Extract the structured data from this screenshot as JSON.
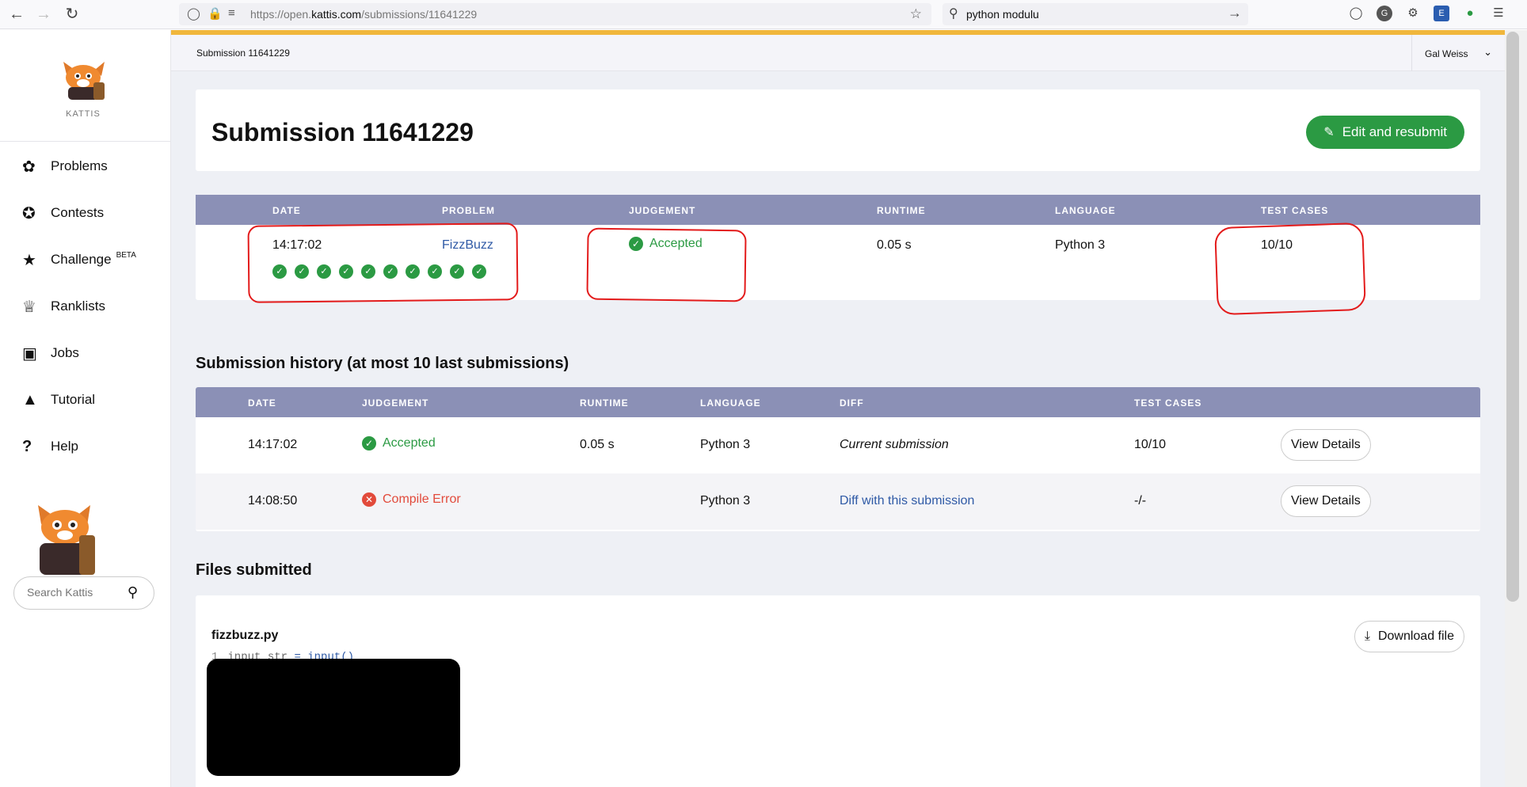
{
  "browser": {
    "url_prefix": "https://open.",
    "url_domain": "kattis.com",
    "url_path": "/submissions/11641229",
    "search_text": "python modulu"
  },
  "sidebar": {
    "logo_text": "KATTIS",
    "items": [
      {
        "label": "Problems",
        "icon": "brain-icon"
      },
      {
        "label": "Contests",
        "icon": "medal-icon"
      },
      {
        "label": "Challenge",
        "icon": "star-icon",
        "badge": "BETA"
      },
      {
        "label": "Ranklists",
        "icon": "trophy-icon"
      },
      {
        "label": "Jobs",
        "icon": "briefcase-icon"
      },
      {
        "label": "Tutorial",
        "icon": "graduation-cap-icon"
      },
      {
        "label": "Help",
        "icon": "question-icon"
      }
    ],
    "search_placeholder": "Search Kattis"
  },
  "topbar": {
    "breadcrumb": "Submission 11641229",
    "user_name": "Gal Weiss"
  },
  "header_card": {
    "title": "Submission 11641229",
    "edit_button": "Edit and resubmit"
  },
  "summary": {
    "headers": [
      "DATE",
      "PROBLEM",
      "JUDGEMENT",
      "RUNTIME",
      "LANGUAGE",
      "TEST CASES"
    ],
    "date": "14:17:02",
    "problem": "FizzBuzz",
    "judgement": "Accepted",
    "runtime": "0.05 s",
    "language": "Python 3",
    "test_cases": "10/10",
    "passed_tests": 10
  },
  "history": {
    "title": "Submission history (at most 10 last submissions)",
    "headers": [
      "DATE",
      "JUDGEMENT",
      "RUNTIME",
      "LANGUAGE",
      "DIFF",
      "TEST CASES"
    ],
    "rows": [
      {
        "date": "14:17:02",
        "judgement": "Accepted",
        "runtime": "0.05 s",
        "language": "Python 3",
        "diff": "Current submission",
        "test_cases": "10/10",
        "button": "View Details"
      },
      {
        "date": "14:08:50",
        "judgement": "Compile Error",
        "runtime": "",
        "language": "Python 3",
        "diff": "Diff with this submission",
        "test_cases": "-/-",
        "button": "View Details"
      }
    ]
  },
  "files": {
    "title": "Files submitted",
    "file_name": "fizzbuzz.py",
    "download_button": "Download file",
    "code_line_number": "1",
    "code_var": "input_str",
    "code_op": "=",
    "code_call": "input()"
  },
  "colors": {
    "accent": "#f0b63c",
    "table_header": "#8b90b6",
    "success": "#2b9a43",
    "error": "#e24a3b",
    "link": "#2f5aa6",
    "annotation": "#e31b1b"
  }
}
